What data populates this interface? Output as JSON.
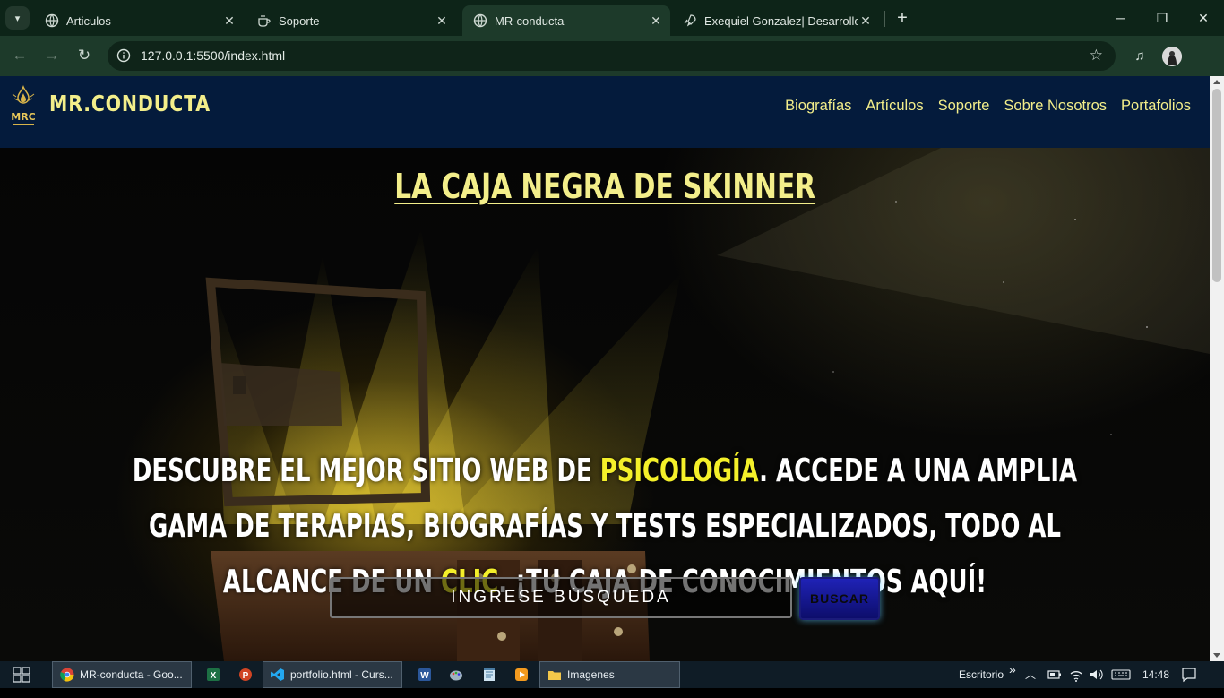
{
  "browser": {
    "tabs": [
      {
        "title": "Articulos",
        "active": false
      },
      {
        "title": "Soporte",
        "active": false
      },
      {
        "title": "MR-conducta",
        "active": true
      },
      {
        "title": "Exequiel Gonzalez| Desarrollo W",
        "active": false
      }
    ],
    "url": "127.0.0.1:5500/index.html"
  },
  "site": {
    "brand": "MR.CONDUCTA",
    "logo_text": "MRC",
    "nav": [
      "Biografías",
      "Artículos",
      "Soporte",
      "Sobre Nosotros",
      "Portafolios"
    ],
    "hero": {
      "title": "LA CAJA NEGRA DE SKINNER",
      "text_parts": [
        "Descubre el mejor sitio web de ",
        "Psicología",
        ". Accede a una amplia gama de terapias, biografías y tests especializados, todo al alcance de un ",
        "clic",
        ". ¡Tu caja de conocimientos aquí!"
      ],
      "search_placeholder": "INGRESE BÚSQUEDA",
      "search_button": "BUSCAR"
    }
  },
  "taskbar": {
    "chrome_item": "MR-conducta - Goo...",
    "editor_item": "portfolio.html - Curs...",
    "folder_item": "Imagenes",
    "desktop_label": "Escritorio",
    "chevron": "»",
    "time": "14:48"
  },
  "colors": {
    "chrome_dark": "#0d2418",
    "chrome_toolbar": "#1d3a2a",
    "site_header": "#041b3c",
    "brand_yellow": "#f3ee8a",
    "highlight_yellow": "#f4f02a",
    "button_blue": "#1f22b6"
  }
}
